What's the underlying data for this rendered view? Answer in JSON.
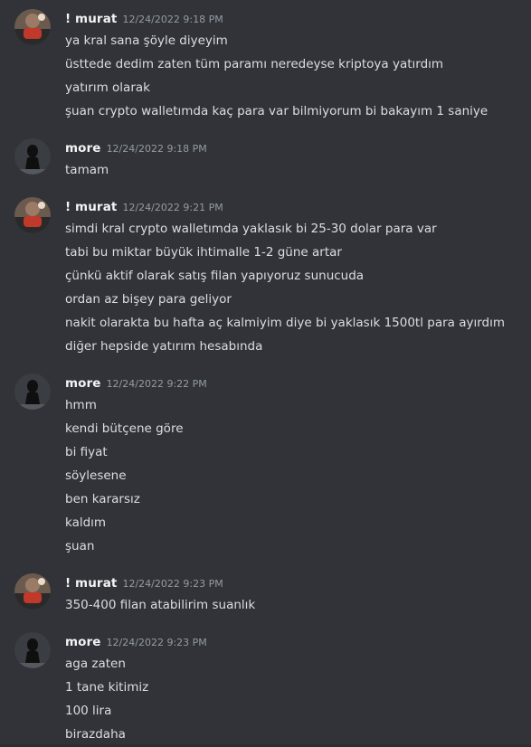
{
  "messages": [
    {
      "author": "! murat",
      "avatar": "murat-avatar",
      "timestamp": "12/24/2022 9:18 PM",
      "lines": [
        "ya kral sana şöyle diyeyim",
        "üsttede dedim zaten tüm paramı neredeyse kriptoya yatırdım",
        "yatırım olarak",
        "şuan crypto walletımda kaç para var bilmiyorum bi bakayım 1 saniye"
      ]
    },
    {
      "author": "more",
      "avatar": "more-avatar",
      "timestamp": "12/24/2022 9:18 PM",
      "lines": [
        "tamam"
      ]
    },
    {
      "author": "! murat",
      "avatar": "murat-avatar",
      "timestamp": "12/24/2022 9:21 PM",
      "lines": [
        "simdi kral crypto walletımda yaklasık bi 25-30 dolar para var",
        "tabi bu miktar büyük ihtimalle 1-2 güne artar",
        "çünkü aktif olarak satış filan yapıyoruz sunucuda",
        "ordan az bişey para geliyor",
        "nakit olarakta bu hafta aç kalmiyim diye bi yaklasık 1500tl para ayırdım",
        "diğer hepside yatırım hesabında"
      ]
    },
    {
      "author": "more",
      "avatar": "more-avatar",
      "timestamp": "12/24/2022 9:22 PM",
      "lines": [
        "hmm",
        "kendi bütçene göre",
        "bi fiyat",
        "söylesene",
        "ben kararsız",
        "kaldım",
        "şuan"
      ]
    },
    {
      "author": "! murat",
      "avatar": "murat-avatar",
      "timestamp": "12/24/2022 9:23 PM",
      "lines": [
        "350-400 filan atabilirim suanlık"
      ]
    },
    {
      "author": "more",
      "avatar": "more-avatar",
      "timestamp": "12/24/2022 9:23 PM",
      "lines": [
        "aga zaten",
        "1 tane kitimiz",
        "100 lira",
        "birazdaha"
      ]
    }
  ],
  "colors": {
    "background": "#313338",
    "username": "#f2f3f5",
    "timestamp": "#949ba4",
    "text": "#dbdee1"
  }
}
